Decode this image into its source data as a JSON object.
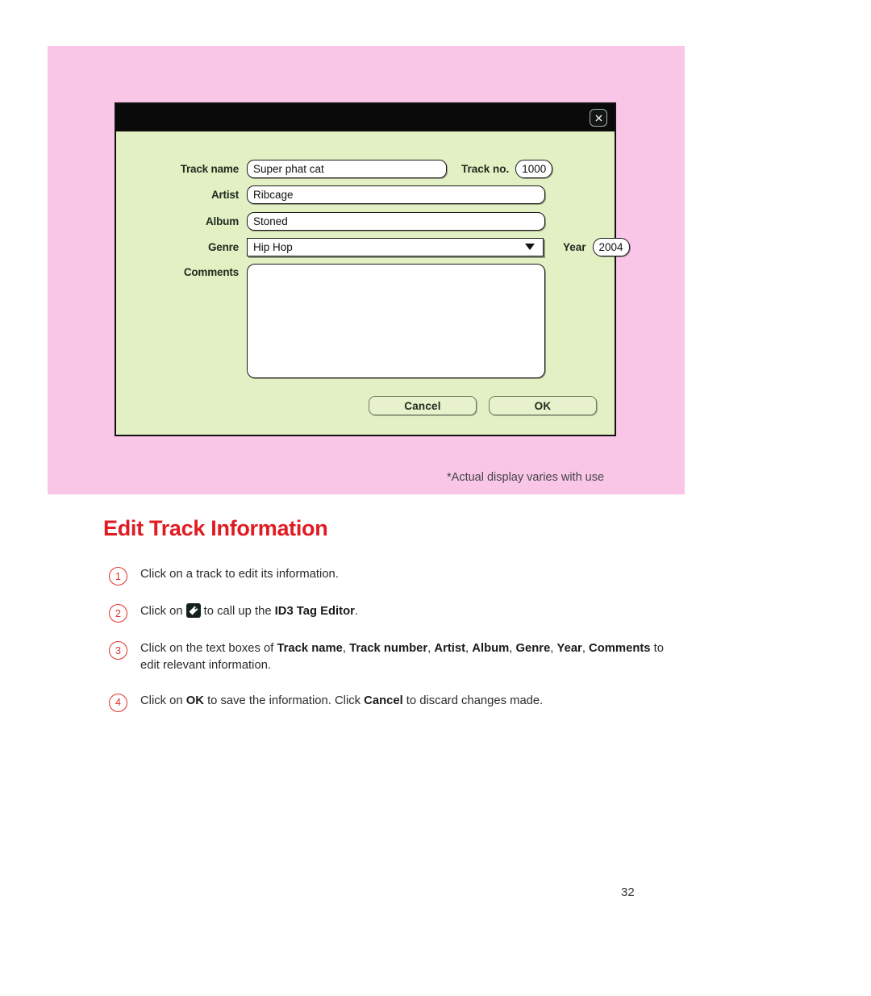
{
  "page": {
    "number": "32",
    "heading": "Edit Track Information",
    "caption": "*Actual display varies with use"
  },
  "dialog": {
    "close_icon": "close-icon",
    "fields": {
      "track_name": {
        "label": "Track name",
        "value": "Super phat cat"
      },
      "track_no": {
        "label": "Track no.",
        "value": "1000"
      },
      "artist": {
        "label": "Artist",
        "value": "Ribcage"
      },
      "album": {
        "label": "Album",
        "value": "Stoned"
      },
      "genre": {
        "label": "Genre",
        "value": "Hip Hop"
      },
      "year": {
        "label": "Year",
        "value": "2004"
      },
      "comments": {
        "label": "Comments",
        "value": ""
      }
    },
    "buttons": {
      "cancel": "Cancel",
      "ok": "OK"
    }
  },
  "steps": [
    {
      "num": "1",
      "pre": "Click on a track to edit its information.",
      "post": "",
      "has_icon": false
    },
    {
      "num": "2",
      "pre": "Click on",
      "mid": "to call up the",
      "bold": "ID3 Tag Editor",
      "post": ".",
      "has_icon": true
    },
    {
      "num": "3",
      "pre": "Click on the text boxes of ",
      "bold_list": [
        "Track name",
        "Track number",
        "Artist",
        "Album",
        "Genre",
        "Year",
        "Comments"
      ],
      "post": " to edit relevant information.",
      "has_icon": false
    },
    {
      "num": "4",
      "pre": "Click on ",
      "bold_ok": "OK",
      "mid": " to save the information.  Click ",
      "bold_cancel": "Cancel",
      "post": " to discard changes made.",
      "has_icon": false
    }
  ],
  "colors": {
    "panel_pink": "#f9c6e7",
    "dialog_green": "#e3f0c4",
    "heading_red": "#e01b22",
    "step_red": "#e0322c",
    "titlebar_black": "#0a0a0a"
  }
}
